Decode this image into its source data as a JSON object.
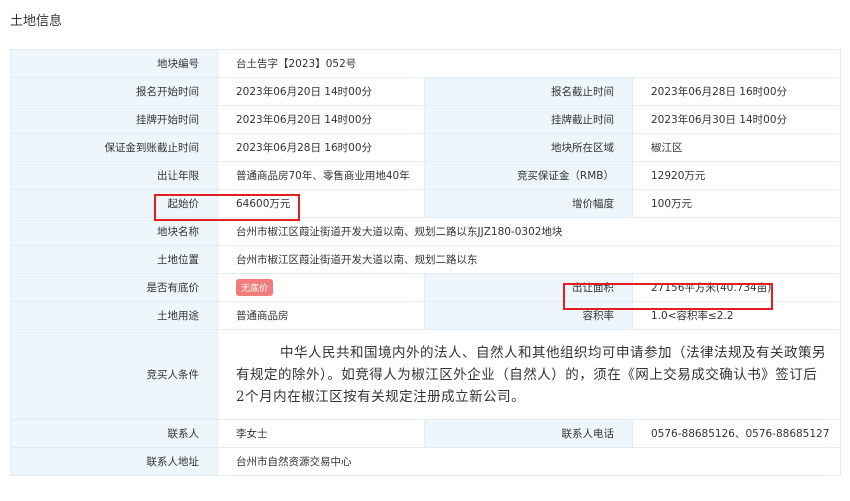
{
  "page": {
    "title": "土地信息"
  },
  "labels": {
    "plot_no": "地块编号",
    "signup_start": "报名开始时间",
    "signup_end": "报名截止时间",
    "listing_start": "挂牌开始时间",
    "listing_end": "挂牌截止时间",
    "deposit_deadline": "保证金到账截止时间",
    "district": "地块所在区域",
    "term": "出让年限",
    "deposit": "竞买保证金（RMB）",
    "start_price": "起始价",
    "increment": "增价幅度",
    "plot_name": "地块名称",
    "location": "土地位置",
    "reserve": "是否有底价",
    "area": "出让面积",
    "usage": "土地用途",
    "far": "容积率",
    "conditions": "竞买人条件",
    "contact": "联系人",
    "phone": "联系人电话",
    "address": "联系人地址"
  },
  "values": {
    "plot_no": "台土告字【2023】052号",
    "signup_start": "2023年06月20日 14时00分",
    "signup_end": "2023年06月28日 16时00分",
    "listing_start": "2023年06月20日 14时00分",
    "listing_end": "2023年06月30日 14时00分",
    "deposit_deadline": "2023年06月28日 16时00分",
    "district": "椒江区",
    "term": "普通商品房70年、零售商业用地40年",
    "deposit": "12920万元",
    "start_price": "64600万元",
    "increment": "100万元",
    "plot_name": "台州市椒江区葭沚街道开发大道以南、规划二路以东JJZ180-0302地块",
    "location": "台州市椒江区葭沚街道开发大道以南、规划二路以东",
    "reserve_badge": "无底价",
    "area": "27156平方米(40.734亩)",
    "usage": "普通商品房",
    "far": "1.0<容积率≤2.2",
    "conditions": "中华人民共和国境内外的法人、自然人和其他组织均可申请参加（法律法规及有关政策另有规定的除外）。如竞得人为椒江区外企业（自然人）的，须在《网上交易成交确认书》签订后2个月内在椒江区按有关规定注册成立新公司。",
    "contact": "李女士",
    "phone": "0576-88685126、0576-88685127",
    "address": "台州市自然资源交易中心"
  },
  "colors": {
    "label_bg": "#eef5fb",
    "border": "#e3ebf3",
    "highlight": "#e02020",
    "badge_bg": "#f07c7c"
  }
}
